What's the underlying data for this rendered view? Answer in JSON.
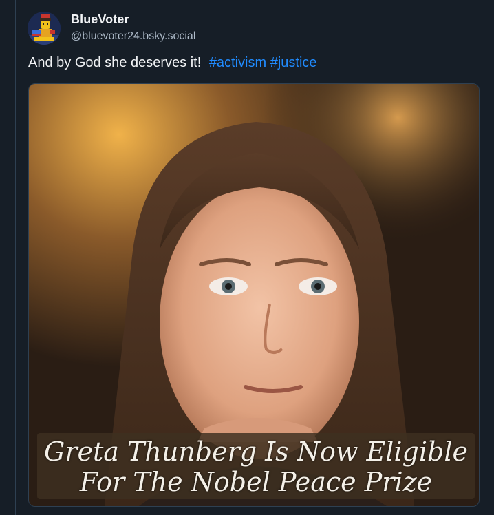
{
  "post": {
    "author": {
      "display_name": "BlueVoter",
      "handle": "@bluevoter24.bsky.social",
      "avatar_icon": "lego-minifigure-avatar"
    },
    "text": "And by God she deserves it!",
    "hashtags": [
      "#activism",
      "#justice"
    ],
    "image": {
      "caption_line_1": "Greta Thunberg Is Now Eligible",
      "caption_line_2": "For The Nobel Peace Prize"
    }
  },
  "colors": {
    "background": "#161e27",
    "link": "#208bfe",
    "text": "#f1f3f5",
    "secondary_text": "#aebbc9",
    "border": "#2e4052"
  }
}
